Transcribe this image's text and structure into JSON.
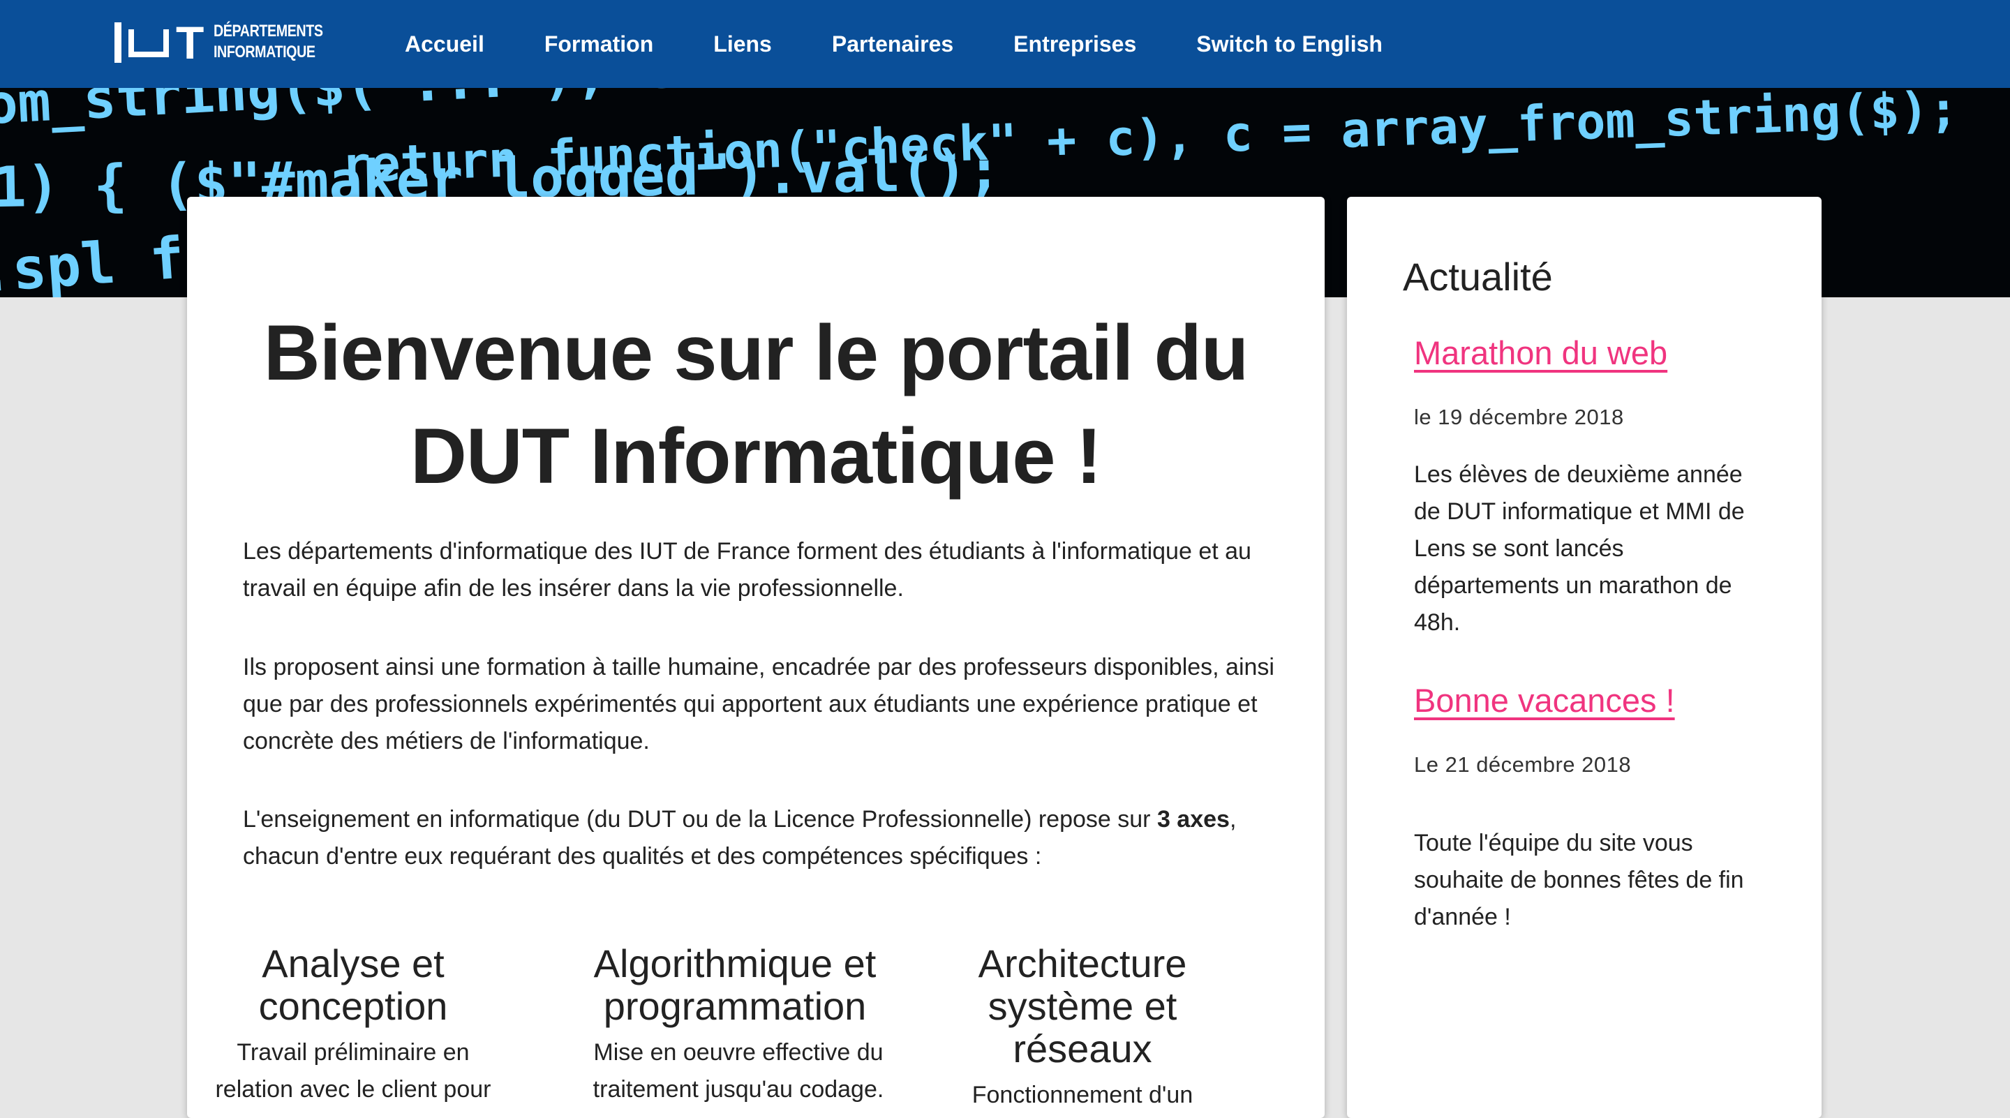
{
  "navbar": {
    "logo_line1": "DÉPARTEMENTS",
    "logo_line2": "INFORMATIQUE",
    "logo_letter": "T",
    "items": [
      {
        "label": "Accueil"
      },
      {
        "label": "Formation"
      },
      {
        "label": "Liens"
      },
      {
        "label": "Partenaires"
      },
      {
        "label": "Entreprises"
      },
      {
        "label": "Switch to English"
      }
    ]
  },
  "hero": {
    "code_lines": [
      "om_string($(   ...   ), this.trigger(  ...  )",
      "return function(\"check\" + c), c = array_from_string($);",
      "1) {        ($\"#maker logged\").val();",
      ".spl                                   from_strin"
    ]
  },
  "main": {
    "title_line1": "Bienvenue sur le portail du",
    "title_line2": "DUT Informatique !",
    "para1": "Les départements d'informatique des IUT de France forment des étudiants à l'informatique et au travail en équipe afin de les insérer dans la vie professionnelle.",
    "para2": "Ils proposent ainsi une formation à taille humaine, encadrée par des professeurs disponibles, ainsi que par des professionnels expérimentés qui apportent aux étudiants une expérience pratique et concrète des métiers de l'informatique.",
    "para3_before": "L'enseignement en informatique (du DUT ou de la Licence Professionnelle) repose sur ",
    "para3_bold": "3 axes",
    "para3_after": ", chacun d'entre eux requérant des qualités et des compétences spécifiques :",
    "axes": [
      {
        "title": "Analyse et conception",
        "text": "Travail préliminaire en relation avec le client pour"
      },
      {
        "title": "Algorithmique et programmation",
        "text": "Mise en oeuvre effective du traitement jusqu'au codage."
      },
      {
        "title": "Architecture système et réseaux",
        "text": "Fonctionnement d'un"
      }
    ]
  },
  "sidebar": {
    "title": "Actualité",
    "news": [
      {
        "title": "Marathon du web",
        "date": "le 19 décembre 2018",
        "text": "Les élèves de deuxième année de DUT informatique et MMI de Lens se sont lancés départements un marathon de 48h."
      },
      {
        "title": "Bonne vacances !",
        "date": "Le 21 décembre 2018",
        "text": "Toute l'équipe du site vous souhaite de bonnes fêtes de fin d'année !"
      }
    ]
  },
  "colors": {
    "navbar": "#0a4f99",
    "link": "#f0347f",
    "code": "#6fd0ff",
    "background": "#e6e6e6"
  }
}
